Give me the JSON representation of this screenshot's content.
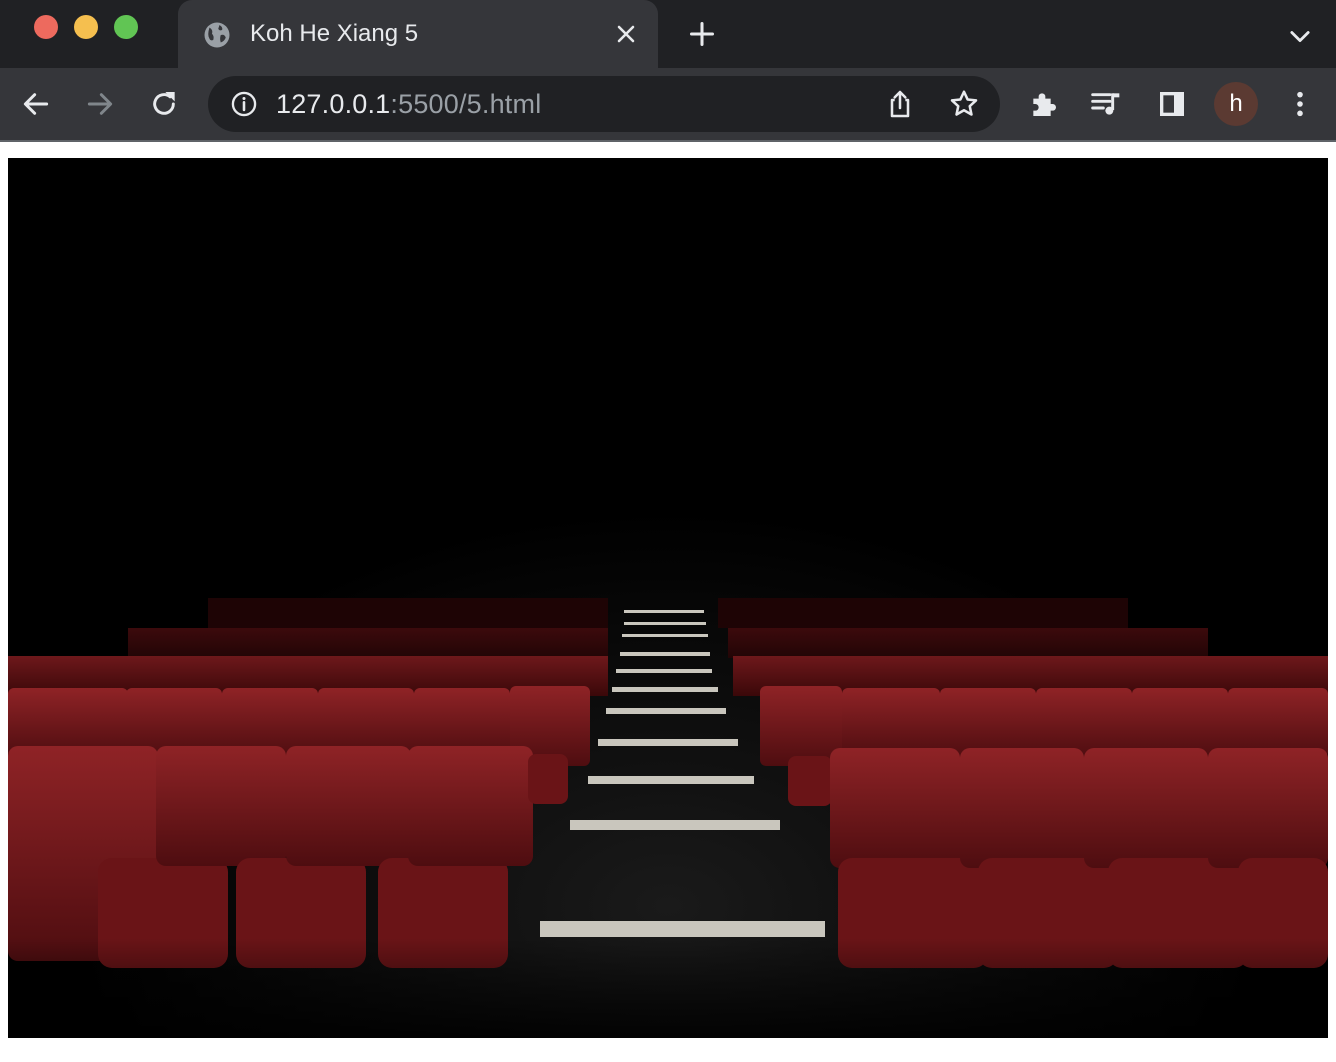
{
  "window": {
    "controls": [
      "close",
      "minimize",
      "zoom"
    ]
  },
  "tab": {
    "title": "Koh He Xiang 5",
    "favicon": "globe-icon",
    "close_icon": "close-icon"
  },
  "tabstrip": {
    "new_tab_icon": "plus-icon",
    "tab_search_icon": "chevron-down-icon"
  },
  "toolbar": {
    "back_icon": "arrow-left-icon",
    "forward_icon": "arrow-right-icon",
    "reload_icon": "reload-icon",
    "omnibox": {
      "url_host": "127.0.0.1",
      "url_rest": ":5500/5.html",
      "info_icon": "info-icon",
      "share_icon": "share-icon",
      "bookmark_icon": "star-icon"
    },
    "extensions_icon": "puzzle-icon",
    "media_icon": "queue-music-icon",
    "side_panel_icon": "side-panel-icon",
    "profile_initial": "h",
    "menu_icon": "more-vert-icon"
  },
  "page": {
    "image_subject": "empty cinema theater with red seats and lit stair steps",
    "colors": {
      "seat": "#7a1a1c",
      "seat_highlight": "#9a2528",
      "step": "#c9c6bd",
      "background": "#000000"
    }
  }
}
